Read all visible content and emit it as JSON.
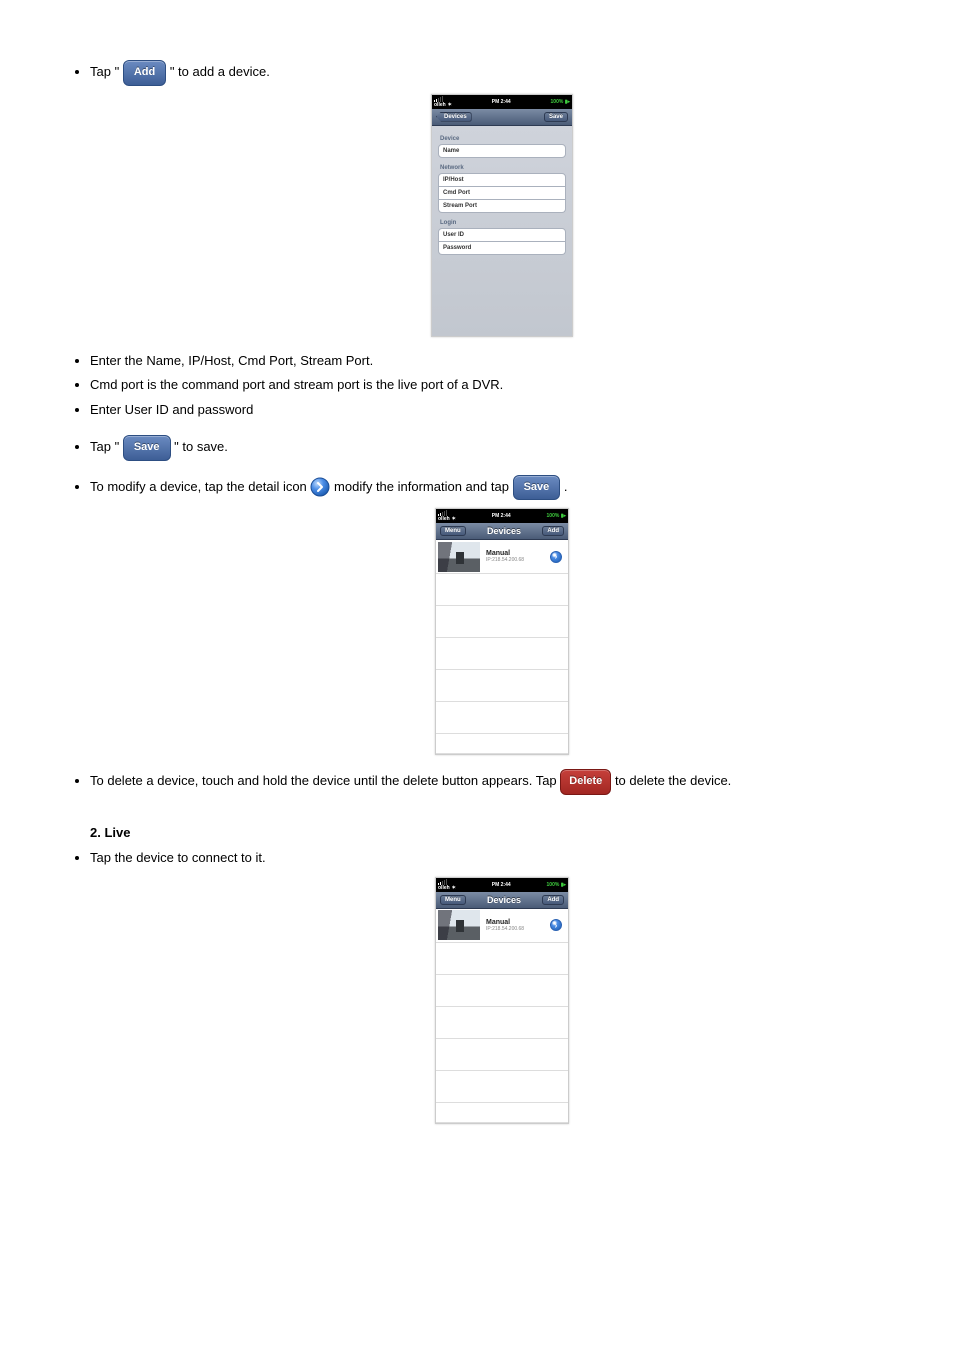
{
  "buttons": {
    "add": "Add",
    "save": "Save",
    "delete": "Delete"
  },
  "bullets": {
    "b1a": "Tap \"",
    "b1b": "\" to add a device.",
    "b2": "Enter the Name, IP/Host, Cmd Port, Stream Port.",
    "b3": "Cmd port is the command port and stream port is the live port of a DVR.",
    "b4": "Enter User ID and password",
    "b5a": "Tap \"",
    "b5b": "\" to save.",
    "b6a": "To modify a device, tap the detail icon",
    "b6b": "modify the information and tap",
    "b6c": ".",
    "b7a": "To delete a device, touch and hold the device until the delete button appears. Tap",
    "b7b": "to delete the device.",
    "b8": "Tap the device to connect to it."
  },
  "section2": "2. Live",
  "detail_icon_alt": "detail-disclosure-icon",
  "phone_form": {
    "status": {
      "carrier": "olleh",
      "time": "PM 2:44",
      "battery": "100%"
    },
    "nav": {
      "left": "Devices",
      "right": "Save"
    },
    "groups": {
      "device": "Device",
      "network": "Network",
      "login": "Login"
    },
    "fields": {
      "name": "Name",
      "iphost": "IP/Host",
      "cmdport": "Cmd Port",
      "streamport": "Stream Port",
      "userid": "User ID",
      "password": "Password"
    }
  },
  "phone_list": {
    "status": {
      "carrier": "olleh",
      "time": "PM 2:44",
      "battery": "100%"
    },
    "nav": {
      "left": "Menu",
      "title": "Devices",
      "right": "Add"
    },
    "row": {
      "name": "Manual",
      "ip": "IP:218.54.200.68"
    }
  }
}
